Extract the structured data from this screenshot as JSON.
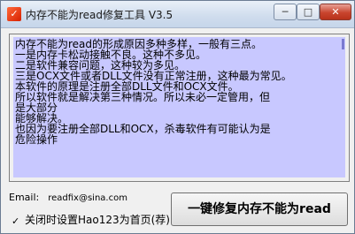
{
  "window": {
    "title": "内存不能为read修复工具 V3.5",
    "icon_glyph": "✓"
  },
  "controls": {
    "minimize": "─",
    "maximize": "□",
    "close": "✕"
  },
  "description_lines": [
    "内存不能为read的形成原因多种多样，一般有三点。",
    "一是内存卡松动接触不良。这种不多见。",
    "二是软件兼容问题，这种较为多见。",
    "三是OCX文件或者DLL文件没有正常注册，这种最为常见。",
    "本软件的原理是注册全部DLL文件和OCX文件。",
    "所以软件就是解决第三种情况。所以未必一定管用，但",
    "是大部分",
    "能够解决。",
    "也因为要注册全部DLL和OCX，杀毒软件有可能认为是",
    "危险操作"
  ],
  "email": {
    "label": "Email:",
    "value": "readfix@sina.com"
  },
  "homepage_checkbox": {
    "checked": true,
    "label": "关闭时设置Hao123为首页(荐)"
  },
  "repair_button_label": "一键修复内存不能为read"
}
